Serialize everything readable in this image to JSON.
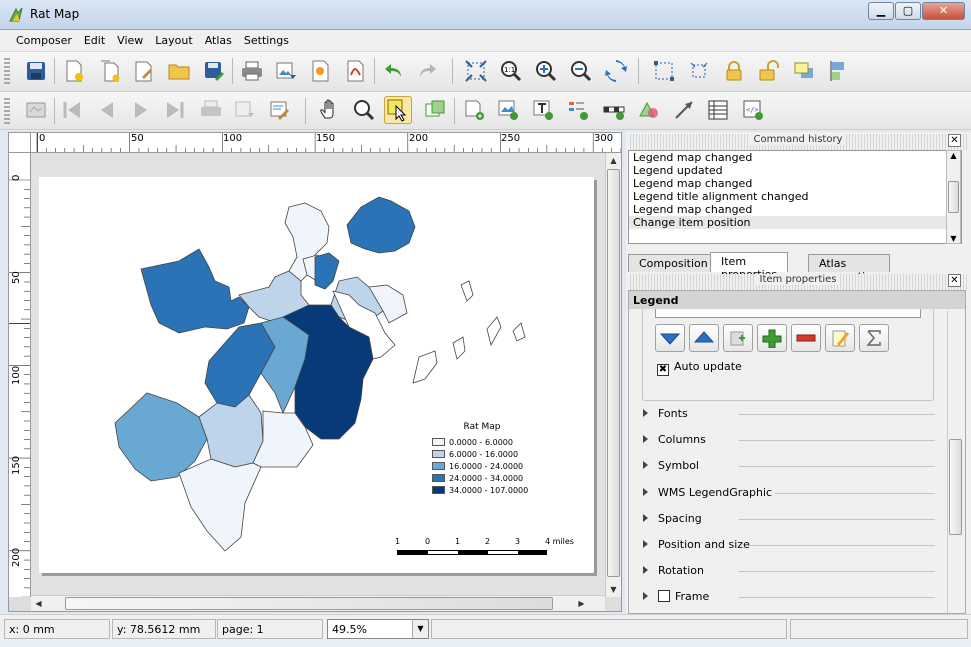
{
  "window": {
    "title": "Rat Map",
    "minimize": "▁",
    "maximize": "▢",
    "close": "✕"
  },
  "menu": [
    "Composer",
    "Edit",
    "View",
    "Layout",
    "Atlas",
    "Settings"
  ],
  "ruler": {
    "h_labels": [
      "0",
      "50",
      "100",
      "150",
      "200",
      "250",
      "300"
    ],
    "v_labels": [
      "0",
      "50",
      "100",
      "150",
      "200"
    ]
  },
  "map": {
    "title": "Rat Map",
    "legend": [
      {
        "label": "0.0000 - 6.0000",
        "color": "#f0f4fb"
      },
      {
        "label": "6.0000 - 16.0000",
        "color": "#bed4ea"
      },
      {
        "label": "16.0000 - 24.0000",
        "color": "#6aa8d4"
      },
      {
        "label": "24.0000 - 34.0000",
        "color": "#2a73b6"
      },
      {
        "label": "34.0000 - 107.0000",
        "color": "#083a7a"
      }
    ],
    "scalebar": {
      "labels": [
        "1",
        "0",
        "1",
        "2",
        "3",
        "4 miles"
      ]
    }
  },
  "dock": {
    "command_history_title": "Command history",
    "history": [
      "Legend map changed",
      "Legend updated",
      "Legend map changed",
      "Legend title alignment changed",
      "Legend map changed",
      "Change item position"
    ],
    "tabs": [
      "Composition",
      "Item properties",
      "Atlas generation"
    ],
    "item_properties_title": "Item properties",
    "panel_header": "Legend",
    "auto_update": "Auto update",
    "sections": [
      "Fonts",
      "Columns",
      "Symbol",
      "WMS LegendGraphic",
      "Spacing",
      "Position and size",
      "Rotation",
      "Frame"
    ]
  },
  "status": {
    "x": "x: 0 mm",
    "y": "y: 78.5612 mm",
    "page": "page: 1",
    "zoom": "49.5%"
  }
}
